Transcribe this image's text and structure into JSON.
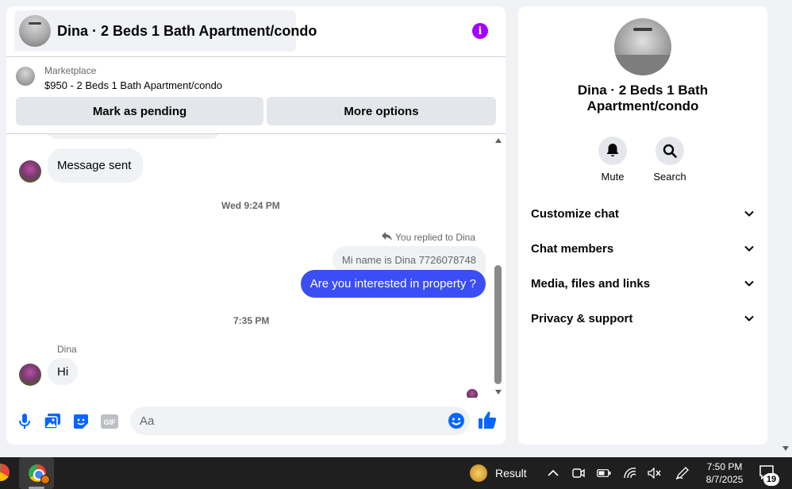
{
  "header": {
    "title": "Dina · 2 Beds 1 Bath Apartment/condo"
  },
  "marketplace": {
    "label": "Marketplace",
    "listing": "$950 - 2 Beds 1 Bath Apartment/condo",
    "mark_pending": "Mark as pending",
    "more_options": "More options"
  },
  "messages": {
    "first_message": "Message sent",
    "time1": "Wed 9:24 PM",
    "reply_note": "You replied to Dina",
    "quoted": "Mi name is Dina 7726078748",
    "outgoing": "Are you interested in property ?",
    "time2": "7:35 PM",
    "sender": "Dina",
    "last_message": "Hi"
  },
  "composer": {
    "placeholder": "Aa"
  },
  "info": {
    "name": "Dina · 2 Beds 1 Bath Apartment/condo",
    "actions": [
      {
        "label": "Mute",
        "icon": "bell-icon"
      },
      {
        "label": "Search",
        "icon": "search-icon"
      }
    ],
    "sections": [
      {
        "label": "Customize chat"
      },
      {
        "label": "Chat members"
      },
      {
        "label": "Media, files and links"
      },
      {
        "label": "Privacy & support"
      }
    ]
  },
  "taskbar": {
    "weather_label": "Result",
    "time": "7:50 PM",
    "date": "8/7/2025",
    "notification_count": "19"
  },
  "colors": {
    "accent": "#0866ff",
    "outgoing_bubble": "#3b4ef5",
    "info_icon": "#a200ff",
    "bubble_in": "#f0f2f5"
  }
}
